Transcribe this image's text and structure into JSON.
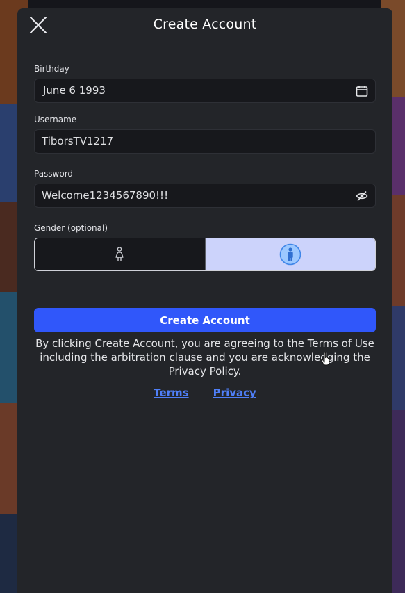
{
  "dialog": {
    "title": "Create Account",
    "close_icon": "close-icon"
  },
  "form": {
    "birthday": {
      "label": "Birthday",
      "value": "June 6 1993",
      "icon": "calendar-icon"
    },
    "username": {
      "label": "Username",
      "value": "TiborsTV1217"
    },
    "password": {
      "label": "Password",
      "value": "Welcome1234567890!!!",
      "icon": "eye-slash-icon"
    },
    "gender": {
      "label": "Gender (optional)",
      "options": [
        {
          "icon": "female-icon",
          "selected": false
        },
        {
          "icon": "male-icon",
          "selected": true
        }
      ]
    }
  },
  "actions": {
    "create_account_label": "Create Account"
  },
  "legal": {
    "text": "By clicking Create Account, you are agreeing to the Terms of Use including the arbitration clause and you are acknowledging the Privacy Policy.",
    "terms_link": "Terms",
    "privacy_link": "Privacy"
  },
  "colors": {
    "primary": "#3057fa",
    "link": "#4f7ff7",
    "selected_option": "#ccd3fb",
    "panel": "#232529"
  }
}
